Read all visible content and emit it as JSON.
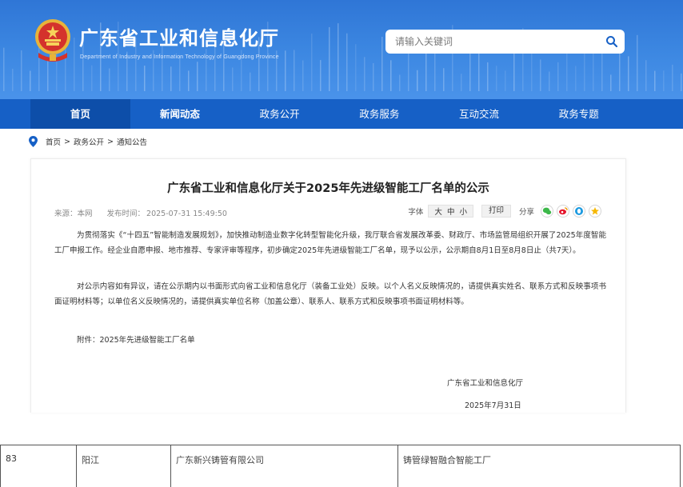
{
  "header": {
    "site_title": "广东省工业和信息化厅",
    "site_subtitle": "Department of Industry and Information Technology of Guangdong Province",
    "search_placeholder": "请输入关键词",
    "emblem_icon": "national-emblem-icon",
    "search_icon": "search-icon",
    "brand_color": "#2f76d6"
  },
  "nav": {
    "items": [
      {
        "label": "首页"
      },
      {
        "label": "新闻动态"
      },
      {
        "label": "政务公开"
      },
      {
        "label": "政务服务"
      },
      {
        "label": "互动交流"
      },
      {
        "label": "政务专题"
      }
    ],
    "color": "#1660c6",
    "active_color": "#0d4ea9"
  },
  "breadcrumb": {
    "items": [
      "首页",
      "政务公开",
      "通知公告"
    ],
    "separator": ">",
    "icon": "location-pin-icon"
  },
  "article": {
    "title": "广东省工业和信息化厅关于2025年先进级智能工厂名单的公示",
    "source_label": "来源：本网",
    "publish_label": "发布时间：",
    "publish_time": "2025-07-31 15:49:50",
    "font_label": "字体",
    "font_sizes": [
      "大",
      "中",
      "小"
    ],
    "print_label": "打印",
    "share_label": "分享",
    "share_icons": [
      "wechat-icon",
      "weibo-icon",
      "qq-icon",
      "qzone-icon"
    ],
    "paragraphs": [
      "为贯彻落实《“十四五”智能制造发展规划》，加快推动制造业数字化转型智能化升级，我厅联合省发展改革委、财政厅、市场监管局组织开展了2025年度智能工厂申报工作。经企业自愿申报、地市推荐、专家评审等程序，初步确定2025年先进级智能工厂名单，现予以公示，公示期自8月1日至8月8日止（共7天）。",
      "对公示内容如有异议，请在公示期内以书面形式向省工业和信息化厅（装备工业处）反映。以个人名义反映情况的，请提供真实姓名、联系方式和反映事项书面证明材料等；以单位名义反映情况的，请提供真实单位名称（加盖公章）、联系人、联系方式和反映事项书面证明材料等。",
      "附件：2025年先进级智能工厂名单"
    ],
    "sign_org": "广东省工业和信息化厅",
    "sign_date": "2025年7月31日"
  },
  "table": {
    "rows": [
      {
        "no": "83",
        "city": "阳江",
        "company": "广东新兴铸管有限公司",
        "factory": "铸管绿智融合智能工厂"
      }
    ]
  }
}
